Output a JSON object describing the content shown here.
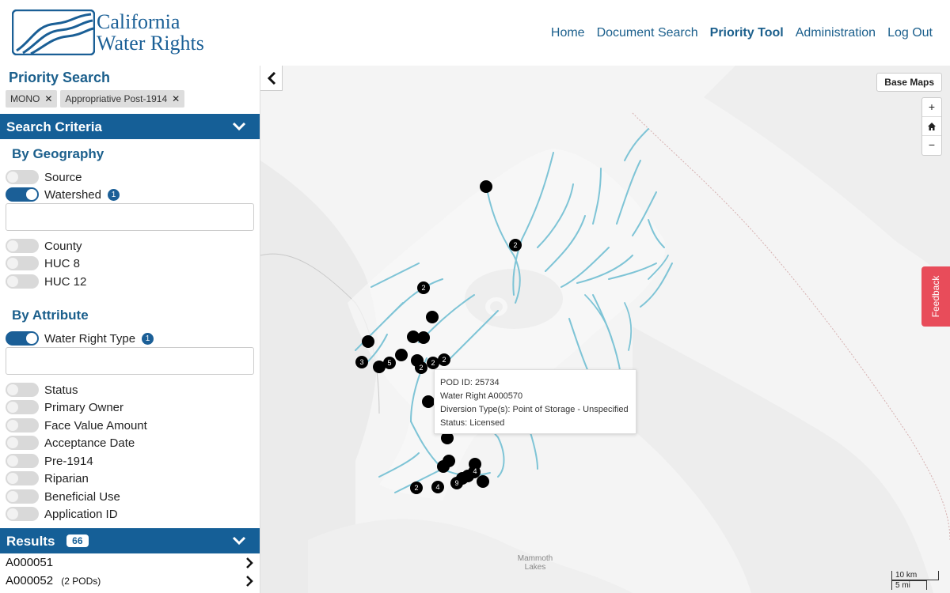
{
  "header": {
    "logo_line1": "California",
    "logo_line2": "Water Rights",
    "nav": [
      "Home",
      "Document Search",
      "Priority Tool",
      "Administration",
      "Log Out"
    ],
    "active_nav": "Priority Tool"
  },
  "sidebar": {
    "title": "Priority Search",
    "chips": [
      "MONO",
      "Appropriative Post-1914"
    ],
    "search_criteria": "Search Criteria",
    "by_geography": "By Geography",
    "geo_toggles": [
      {
        "label": "Source",
        "on": false
      },
      {
        "label": "Watershed",
        "on": true,
        "count": "1"
      },
      {
        "label": "County",
        "on": false
      },
      {
        "label": "HUC 8",
        "on": false
      },
      {
        "label": "HUC 12",
        "on": false
      }
    ],
    "by_attribute": "By Attribute",
    "attr_toggles": [
      {
        "label": "Water Right Type",
        "on": true,
        "count": "1"
      },
      {
        "label": "Status",
        "on": false
      },
      {
        "label": "Primary Owner",
        "on": false
      },
      {
        "label": "Face Value Amount",
        "on": false
      },
      {
        "label": "Acceptance Date",
        "on": false
      },
      {
        "label": "Pre-1914",
        "on": false
      },
      {
        "label": "Riparian",
        "on": false
      },
      {
        "label": "Beneficial Use",
        "on": false
      },
      {
        "label": "Application ID",
        "on": false
      }
    ],
    "results_label": "Results",
    "results_count": "66",
    "results": [
      {
        "id": "A000051",
        "pods": ""
      },
      {
        "id": "A000052",
        "pods": "(2 PODs)"
      }
    ]
  },
  "map": {
    "base_maps": "Base Maps",
    "zoom_in": "+",
    "zoom_out": "−",
    "feedback": "Feedback",
    "tooltip": {
      "pod": "POD ID: 25734",
      "right": "Water Right A000570",
      "diversion": "Diversion Type(s): Point of Storage - Unspecified",
      "status": "Status: Licensed"
    },
    "scale_km": "10 km",
    "scale_mi": "5 mi",
    "place": "Mammoth Lakes",
    "cluster_labels": [
      "2",
      "2",
      "3",
      "5",
      "2",
      "2",
      "2",
      "4",
      "9",
      "4",
      "2"
    ]
  },
  "colors": {
    "brand": "#155f97",
    "stream": "#7ec4d6",
    "feedback": "#e84c5a"
  }
}
